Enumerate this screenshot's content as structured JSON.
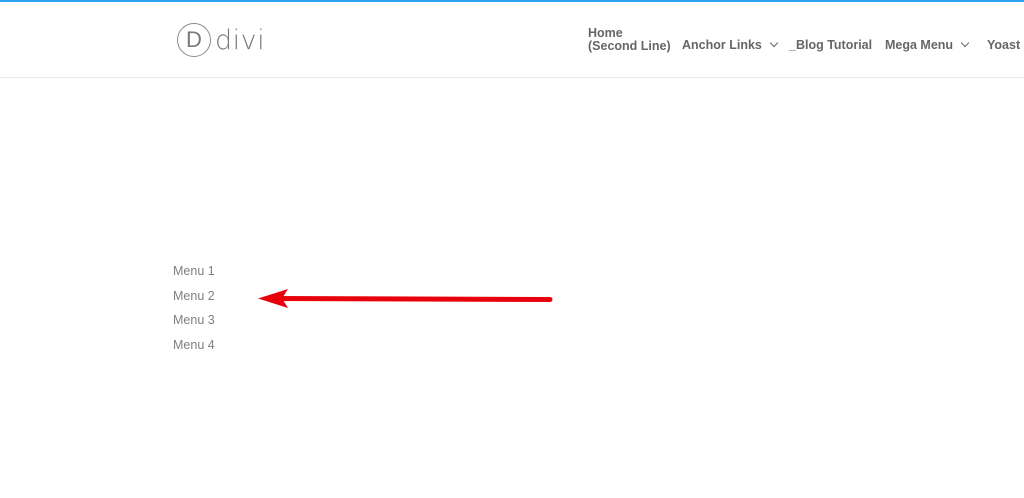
{
  "theme": {
    "accent_color": "#2ea3f2",
    "arrow_color": "#e8000b",
    "text_color": "#666666",
    "menu_text_color": "#808080"
  },
  "header": {
    "logo": {
      "mark": "D",
      "word": "divi"
    },
    "nav": {
      "items": [
        {
          "line1": "Home",
          "line2": "(Second Line)"
        },
        {
          "label": "Anchor Links",
          "has_dropdown": true,
          "icon": "chevron-down-icon"
        },
        {
          "label": "_Blog Tutorial",
          "has_dropdown": false
        },
        {
          "label": "Mega Menu",
          "has_dropdown": true,
          "icon": "chevron-down-icon"
        },
        {
          "label": "Yoast",
          "has_dropdown": false
        }
      ]
    }
  },
  "main": {
    "menu": {
      "items": [
        {
          "label": "Menu 1"
        },
        {
          "label": "Menu 2"
        },
        {
          "label": "Menu 3"
        },
        {
          "label": "Menu 4"
        }
      ]
    },
    "annotation": {
      "icon": "arrow-left-icon",
      "points_to": "Menu 2"
    }
  }
}
